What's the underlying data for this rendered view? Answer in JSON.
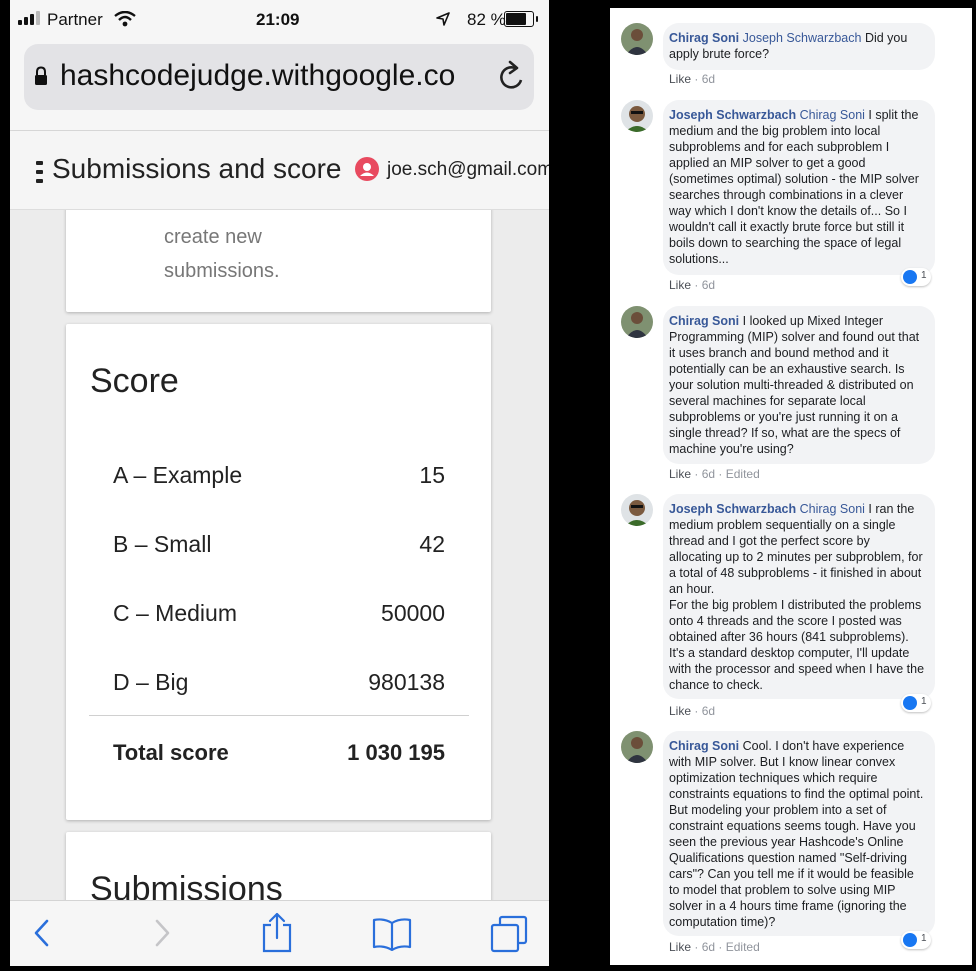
{
  "status_bar": {
    "carrier": "Partner",
    "time": "21:09",
    "battery": "82 %",
    "battery_level": 0.82
  },
  "browser": {
    "url": "hashcodejudge.withgoogle.co"
  },
  "app_bar": {
    "title": "Submissions and score",
    "user_email": "joe.sch@gmail.com"
  },
  "info_card": {
    "line1": "create new",
    "line2": "submissions."
  },
  "score_card": {
    "heading": "Score",
    "rows": [
      {
        "label": "A – Example",
        "value": "15"
      },
      {
        "label": "B – Small",
        "value": "42"
      },
      {
        "label": "C – Medium",
        "value": "50000"
      },
      {
        "label": "D – Big",
        "value": "980138"
      }
    ],
    "total_label": "Total score",
    "total_value": "1 030 195"
  },
  "submissions_card": {
    "heading": "Submissions"
  },
  "comments": [
    {
      "author": "Chirag Soni",
      "mention": "Joseph Schwarzbach",
      "text": " Did you apply brute force?",
      "like": "Like",
      "age": "6d",
      "edited": "",
      "reactions": ""
    },
    {
      "author": "Joseph Schwarzbach",
      "mention": "Chirag Soni",
      "text": " I split the medium and the big problem into local subproblems and for each subproblem I applied an MIP solver to get a good (sometimes optimal) solution - the MIP solver searches through combinations in a clever way which I don't know the details of... So I wouldn't call it exactly brute force but still it boils down to searching the space of legal solutions...",
      "like": "Like",
      "age": "6d",
      "edited": "",
      "reactions": "1"
    },
    {
      "author": "Chirag Soni",
      "mention": "",
      "text": " I looked up Mixed Integer Programming (MIP) solver and found out that it uses branch and bound method and it potentially can be an exhaustive search. Is your solution multi-threaded & distributed on several machines for separate local subproblems or you're just running it on a single thread? If so, what are the specs of machine you're using?",
      "like": "Like",
      "age": "6d",
      "edited": "Edited",
      "reactions": ""
    },
    {
      "author": "Joseph Schwarzbach",
      "mention": "Chirag Soni",
      "text": " I ran the medium problem sequentially on a single thread and I got the perfect score by allocating up to 2 minutes per subproblem, for a total of 48 subproblems - it finished in about an hour.",
      "text2": "For the big problem I distributed the problems onto 4 threads and the score I posted was obtained after 36 hours (841 subproblems). It's a standard desktop computer, I'll update with the processor and speed when I have the chance to check.",
      "like": "Like",
      "age": "6d",
      "edited": "",
      "reactions": "1"
    },
    {
      "author": "Chirag Soni",
      "mention": "",
      "text": " Cool. I don't have experience with MIP solver. But I know linear convex optimization techniques which require constraints equations to find the optimal point. But modeling your problem into a set of constraint equations seems tough. Have you seen the previous year Hashcode's Online Qualifications question named \"Self-driving cars\"? Can you tell me if it would be feasible to model that problem to solve using MIP solver in a 4 hours time frame (ignoring the computation time)?",
      "like": "Like",
      "age": "6d",
      "edited": "Edited",
      "reactions": "1"
    }
  ]
}
